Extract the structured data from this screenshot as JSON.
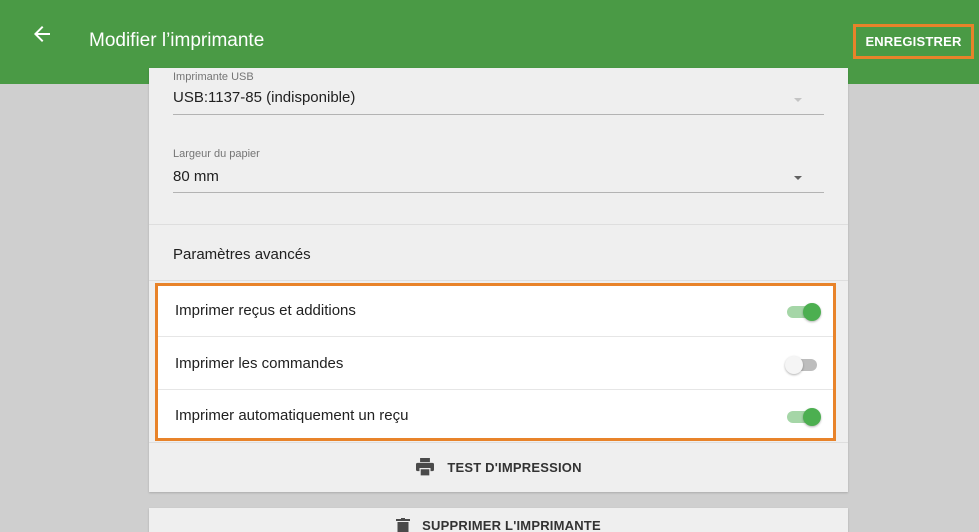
{
  "appbar": {
    "background": "#4a9a45",
    "back_icon": "arrow-left-icon",
    "title": "Modifier l’imprimante",
    "save_label": "ENREGISTRER"
  },
  "form": {
    "usb_printer": {
      "label": "Imprimante USB",
      "value": "USB:1137-85 (indisponible)",
      "icon": "chevron-down-icon"
    },
    "paper_width": {
      "label": "Largeur du papier",
      "value": "80 mm",
      "icon": "chevron-down-icon"
    }
  },
  "advanced": {
    "header": "Paramètres avancés",
    "toggles": [
      {
        "label": "Imprimer reçus et additions",
        "checked": true
      },
      {
        "label": "Imprimer les commandes",
        "checked": false
      },
      {
        "label": "Imprimer automatiquement un reçu",
        "checked": true
      }
    ]
  },
  "actions": {
    "test_print_label": "TEST D'IMPRESSION",
    "test_print_icon": "printer-icon",
    "delete_label": "SUPPRIMER L'IMPRIMANTE",
    "delete_icon": "trash-icon"
  },
  "colors": {
    "accent": "#4caf50",
    "highlight": "#e8832a"
  }
}
